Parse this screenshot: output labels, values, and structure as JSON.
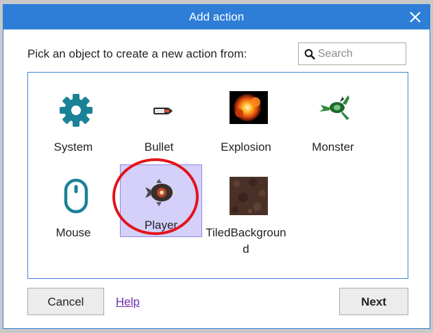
{
  "dialog": {
    "title": "Add action",
    "prompt": "Pick an object to create a new action from:",
    "search": {
      "placeholder": "Search",
      "value": ""
    },
    "objects": [
      {
        "label": "System",
        "icon": "gear-icon"
      },
      {
        "label": "Bullet",
        "icon": "bullet-icon"
      },
      {
        "label": "Explosion",
        "icon": "explosion-icon"
      },
      {
        "label": "Monster",
        "icon": "monster-icon"
      },
      {
        "label": "Mouse",
        "icon": "mouse-icon"
      },
      {
        "label": "Player",
        "icon": "player-icon",
        "selected": true
      },
      {
        "label": "TiledBackground",
        "icon": "tiled-background-icon"
      }
    ],
    "buttons": {
      "cancel": "Cancel",
      "help": "Help",
      "next": "Next"
    }
  },
  "colors": {
    "titlebar": "#2e7ed8",
    "selection": "#d4d0fa",
    "highlight_ring": "#e3141b",
    "help_link": "#6b2aa8"
  }
}
